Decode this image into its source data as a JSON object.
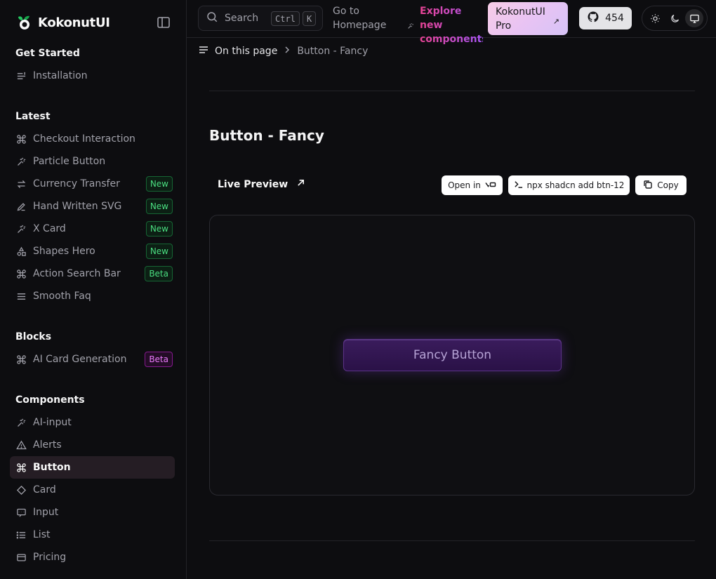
{
  "brand": {
    "name": "KokonutUI"
  },
  "nav": {
    "sections": {
      "get_started": "Get Started",
      "latest": "Latest",
      "blocks": "Blocks",
      "components": "Components"
    },
    "get_started": [
      {
        "label": "Installation",
        "icon": "list-icon"
      }
    ],
    "latest": [
      {
        "label": "Checkout Interaction",
        "icon": "command-icon"
      },
      {
        "label": "Particle Button",
        "icon": "sparkle-icon"
      },
      {
        "label": "Currency Transfer",
        "icon": "transfer-icon",
        "badge": "New"
      },
      {
        "label": "Hand Written SVG",
        "icon": "pen-icon",
        "badge": "New"
      },
      {
        "label": "X Card",
        "icon": "sparkle-icon",
        "badge": "New"
      },
      {
        "label": "Shapes Hero",
        "icon": "shapes-icon",
        "badge": "New"
      },
      {
        "label": "Action Search Bar",
        "icon": "command-icon",
        "badge": "Beta"
      },
      {
        "label": "Smooth Faq",
        "icon": "menu-icon"
      }
    ],
    "blocks": [
      {
        "label": "AI Card Generation",
        "icon": "command-icon",
        "badge": "Beta"
      }
    ],
    "components": [
      {
        "label": "AI-input",
        "icon": "sparkle-icon"
      },
      {
        "label": "Alerts",
        "icon": "warning-icon"
      },
      {
        "label": "Button",
        "icon": "command-icon",
        "active": true
      },
      {
        "label": "Card",
        "icon": "diamond-icon"
      },
      {
        "label": "Input",
        "icon": "message-icon"
      },
      {
        "label": "List",
        "icon": "list-icon"
      },
      {
        "label": "Pricing",
        "icon": "card-icon"
      }
    ]
  },
  "topbar": {
    "search_label": "Search",
    "kbd_ctrl": "Ctrl",
    "kbd_k": "K",
    "goto": "Go to Homepage",
    "explore": "Explore new components",
    "pro": "KokonutUI Pro",
    "github_count": "454"
  },
  "breadcrumb": {
    "root": "On this page",
    "current": "Button - Fancy"
  },
  "page": {
    "title": "Button - Fancy",
    "live_preview": "Live Preview",
    "open_in": "Open in",
    "install_cmd": "npx shadcn add btn-12",
    "copy": "Copy",
    "fancy_button": "Fancy Button"
  },
  "colors": {
    "background": "#0d0d10",
    "accent_pink": "#e84393",
    "accent_purple": "#a855f7",
    "badge_green": "#4ade80",
    "badge_pink": "#e879f9",
    "active_item": "#251d24"
  }
}
